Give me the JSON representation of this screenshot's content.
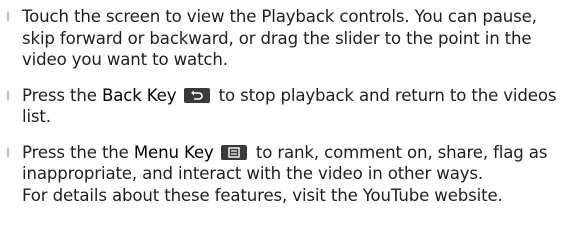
{
  "items": [
    {
      "text": "Touch the screen to view the Playback controls. You can pause, skip forward or backward, or drag the slider to the point in the video you want to watch."
    },
    {
      "before": "Press the ",
      "key_label": "Back Key",
      "key_icon": "back-key-icon",
      "after": " to stop playback and return to the videos list."
    },
    {
      "before": "Press the the ",
      "key_label": "Menu Key",
      "key_icon": "menu-key-icon",
      "after": " to rank, comment on, share, flag as inappropriate, and interact with the video in other ways.",
      "note": "For details about these features, visit the YouTube website."
    }
  ]
}
